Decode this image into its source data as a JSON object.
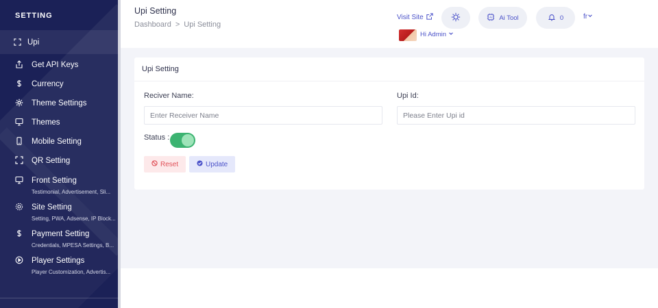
{
  "sidebar": {
    "heading": "SETTING",
    "active_item": "Upi",
    "items": [
      {
        "label": "Get API Keys",
        "sub": ""
      },
      {
        "label": "Currency",
        "sub": ""
      },
      {
        "label": "Theme Settings",
        "sub": ""
      },
      {
        "label": "Themes",
        "sub": ""
      },
      {
        "label": "Mobile Setting",
        "sub": ""
      },
      {
        "label": "QR Setting",
        "sub": ""
      },
      {
        "label": "Front Setting",
        "sub": "Testimonial, Advertisement, Sli..."
      },
      {
        "label": "Site Setting",
        "sub": "Setting, PWA, Adsense, IP Block..."
      },
      {
        "label": "Payment Setting",
        "sub": "Credentials, MPESA Settings, B..."
      },
      {
        "label": "Player Settings",
        "sub": "Player Customization, Advertis..."
      }
    ]
  },
  "header": {
    "title": "Upi Setting",
    "breadcrumb": {
      "root": "Dashboard",
      "separator": ">",
      "current": "Upi Setting"
    },
    "visit_site": "Visit Site",
    "ai_tool": "Ai Tool",
    "notifications_count": "0",
    "language": "fr",
    "user_greeting": "Hi Admin"
  },
  "card": {
    "title": "Upi Setting",
    "receiver_label": "Reciver Name:",
    "receiver_placeholder": "Enter Receiver Name",
    "upi_label": "Upi Id:",
    "upi_placeholder": "Please Enter Upi id",
    "status_label": "Status :",
    "status_on": true,
    "reset_label": "Reset",
    "update_label": "Update"
  },
  "colors": {
    "sidebar_bg": "#1b2157",
    "accent": "#4b52c9",
    "toggle_on": "#3cb371",
    "reset": "#e05058"
  }
}
